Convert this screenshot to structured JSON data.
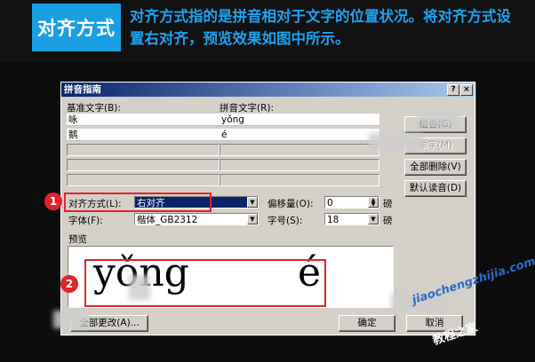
{
  "header": {
    "tag": "对齐方式",
    "description": "对齐方式指的是拼音相对于文字的位置状况。将对齐方式设置右对齐，预览效果如图中所示。"
  },
  "dialog": {
    "title": "拼音指南",
    "help_btn": "?",
    "close_btn": "×",
    "base_text_label": "基准文字(B):",
    "ruby_text_label": "拼音文字(R):",
    "rows": [
      {
        "base": "咏",
        "ruby": "yǒng"
      },
      {
        "base": "鹅",
        "ruby": "é"
      }
    ],
    "buttons": {
      "combine": "组合(G)",
      "single": "单字(M)",
      "delete_all": "全部删除(V)",
      "default_reading": "默认读音(D)",
      "apply_all": "全部更改(A)...",
      "ok": "确定",
      "cancel": "取消"
    },
    "alignment_label": "对齐方式(L):",
    "alignment_value": "右对齐",
    "offset_label": "偏移量(O):",
    "offset_value": "0",
    "offset_unit": "磅",
    "font_label": "字体(F):",
    "font_value": "楷体_GB2312",
    "size_label": "字号(S):",
    "size_value": "18",
    "size_unit": "磅",
    "preview_label": "预览",
    "preview_ruby": [
      "yǒng",
      "é"
    ]
  },
  "markers": [
    "1",
    "2"
  ],
  "watermark": {
    "url": "jiaochengzhijia.com",
    "name": "教程之家"
  },
  "colors": {
    "accent": "#1a9ee3",
    "highlight": "#e0242c",
    "selection": "#0a246a",
    "dialog_bg": "#d4d0c8"
  }
}
